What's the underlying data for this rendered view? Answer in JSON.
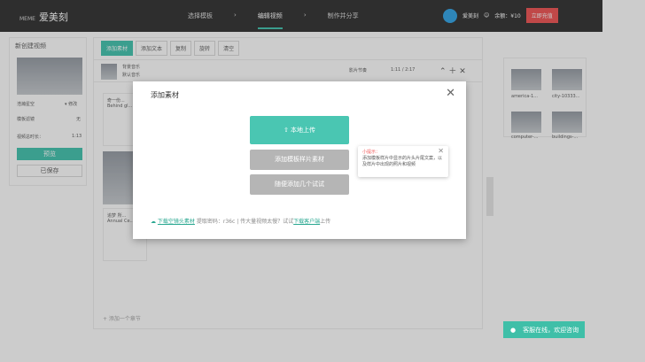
{
  "header": {
    "logo_small": "MEME",
    "logo": "爱美刻",
    "steps": [
      "选择模板",
      "编辑视频",
      "制作并分享"
    ],
    "username": "爱美刻",
    "balance": "余额：¥10",
    "recharge": "立即充值"
  },
  "left": {
    "title": "新创建视频",
    "music": "浩瀚星空",
    "music_action": "▾ 修改",
    "template_filter": "模板滤镜",
    "filter_value": "无",
    "duration_label": "视频总时长：",
    "duration": "1:13",
    "preview": "预览",
    "saved": "已保存"
  },
  "toolbar": {
    "add_material": "添加素材",
    "add_text": "添加文本",
    "copy": "复制",
    "rotate": "旋转",
    "clear": "清空"
  },
  "music_row": {
    "name": "背景音乐",
    "sub": "默认音乐",
    "beat": "影片节奏",
    "time": "1:11 / 2:17"
  },
  "scenes": [
    {
      "title": "奇一份...",
      "sub": "Behind gl..."
    },
    {
      "title": "追梦 所...",
      "sub": "Annual Ce..."
    }
  ],
  "add_chapter": "+ 添加一个章节",
  "right": {
    "items": [
      "america-1...",
      "city-10333...",
      "computer-...",
      "buildings-..."
    ]
  },
  "modal": {
    "title": "添加素材",
    "upload": "本地上传",
    "add_template": "添加模板样片素材",
    "add_random": "随便添加几个试试",
    "tip_title": "小提示：",
    "tip_text": "添加模板样片中显示的片头片尾文案，以及样片中出现的照片和视频",
    "download_link": "下载空镜头素材",
    "password": "提取密码：r36c",
    "sep": "|",
    "slow_text": "传大量视频太慢？试试",
    "client_link": "下载客户端",
    "upload_suffix": "上传"
  },
  "chat": "客服在线，欢迎咨询"
}
